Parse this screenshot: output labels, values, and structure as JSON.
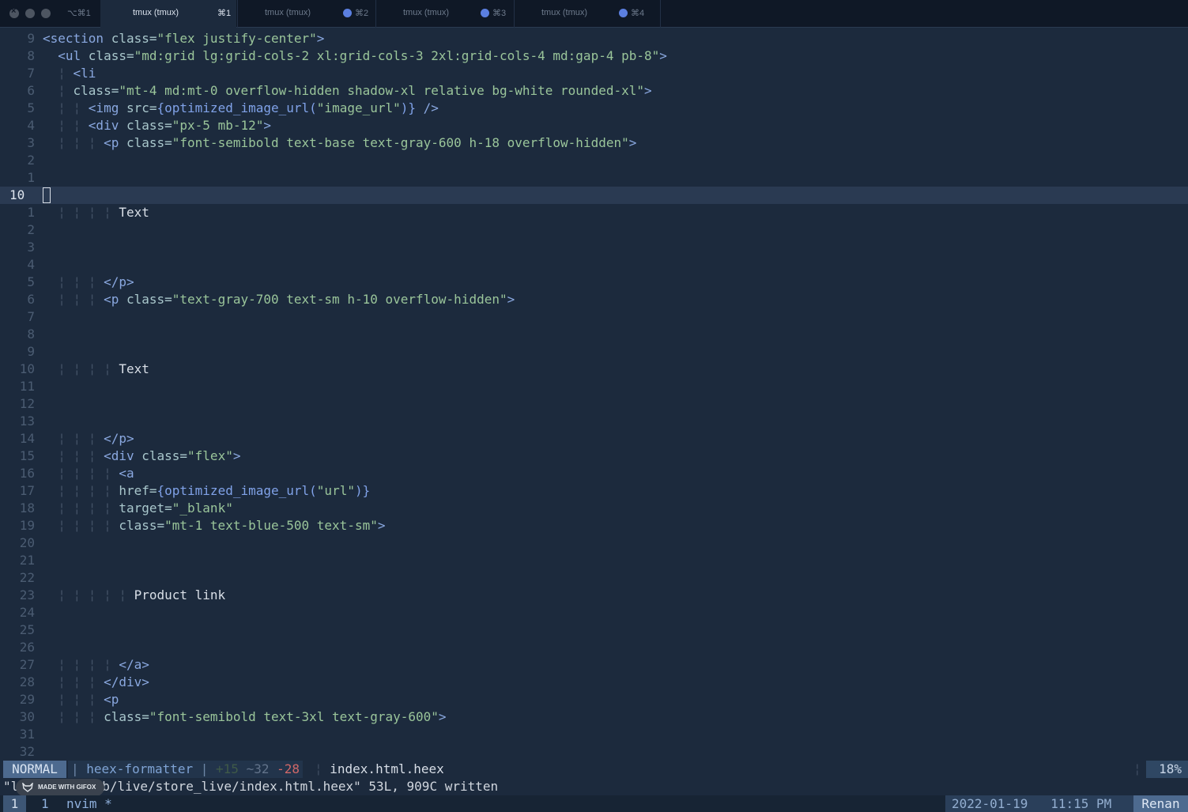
{
  "titlebar": {
    "window_shortcut": "⌥⌘1",
    "tabs": [
      {
        "title": "tmux (tmux)",
        "shortcut": "⌘1",
        "active": true
      },
      {
        "title": "tmux (tmux)",
        "shortcut": "⌘2",
        "active": false
      },
      {
        "title": "tmux (tmux)",
        "shortcut": "⌘3",
        "active": false
      },
      {
        "title": "tmux (tmux)",
        "shortcut": "⌘4",
        "active": false
      }
    ]
  },
  "editor": {
    "lines": [
      {
        "num": "9",
        "tokens": [
          {
            "c": "t",
            "v": "<section "
          },
          {
            "c": "a",
            "v": "class="
          },
          {
            "c": "s",
            "v": "\"flex justify-center\""
          },
          {
            "c": "t",
            "v": ">"
          }
        ]
      },
      {
        "num": "8",
        "tokens": [
          {
            "c": "t",
            "v": "  <ul "
          },
          {
            "c": "a",
            "v": "class="
          },
          {
            "c": "s",
            "v": "\"md:grid lg:grid-cols-2 xl:grid-cols-3 2xl:grid-cols-4 md:gap-4 pb-8\""
          },
          {
            "c": "t",
            "v": ">"
          }
        ]
      },
      {
        "num": "7",
        "tokens": [
          {
            "c": "g",
            "v": "  ¦ "
          },
          {
            "c": "t",
            "v": "<li"
          }
        ]
      },
      {
        "num": "6",
        "tokens": [
          {
            "c": "g",
            "v": "  ¦ "
          },
          {
            "c": "a",
            "v": "class="
          },
          {
            "c": "s",
            "v": "\"mt-4 md:mt-0 overflow-hidden shadow-xl relative bg-white rounded-xl\""
          },
          {
            "c": "t",
            "v": ">"
          }
        ]
      },
      {
        "num": "5",
        "tokens": [
          {
            "c": "g",
            "v": "  ¦ ¦ "
          },
          {
            "c": "t",
            "v": "<img "
          },
          {
            "c": "a",
            "v": "src="
          },
          {
            "c": "f",
            "v": "{optimized_image_url("
          },
          {
            "c": "s",
            "v": "\"image_url\""
          },
          {
            "c": "f",
            "v": ")}"
          },
          {
            "c": "t",
            "v": " />"
          }
        ]
      },
      {
        "num": "4",
        "tokens": [
          {
            "c": "g",
            "v": "  ¦ ¦ "
          },
          {
            "c": "t",
            "v": "<div "
          },
          {
            "c": "a",
            "v": "class="
          },
          {
            "c": "s",
            "v": "\"px-5 mb-12\""
          },
          {
            "c": "t",
            "v": ">"
          }
        ]
      },
      {
        "num": "3",
        "tokens": [
          {
            "c": "g",
            "v": "  ¦ ¦ ¦ "
          },
          {
            "c": "t",
            "v": "<p "
          },
          {
            "c": "a",
            "v": "class="
          },
          {
            "c": "s",
            "v": "\"font-semibold text-base text-gray-600 h-18 overflow-hidden\""
          },
          {
            "c": "t",
            "v": ">"
          }
        ]
      },
      {
        "num": "2",
        "tokens": []
      },
      {
        "num": "1",
        "tokens": []
      },
      {
        "num": "10",
        "tokens": [],
        "current": true
      },
      {
        "num": "1",
        "tokens": [
          {
            "c": "g",
            "v": "  ¦ ¦ ¦ ¦ "
          },
          {
            "c": "x",
            "v": "Text"
          }
        ]
      },
      {
        "num": "2",
        "tokens": []
      },
      {
        "num": "3",
        "tokens": []
      },
      {
        "num": "4",
        "tokens": []
      },
      {
        "num": "5",
        "tokens": [
          {
            "c": "g",
            "v": "  ¦ ¦ ¦ "
          },
          {
            "c": "t",
            "v": "</p>"
          }
        ]
      },
      {
        "num": "6",
        "tokens": [
          {
            "c": "g",
            "v": "  ¦ ¦ ¦ "
          },
          {
            "c": "t",
            "v": "<p "
          },
          {
            "c": "a",
            "v": "class="
          },
          {
            "c": "s",
            "v": "\"text-gray-700 text-sm h-10 overflow-hidden\""
          },
          {
            "c": "t",
            "v": ">"
          }
        ]
      },
      {
        "num": "7",
        "tokens": []
      },
      {
        "num": "8",
        "tokens": []
      },
      {
        "num": "9",
        "tokens": []
      },
      {
        "num": "10",
        "tokens": [
          {
            "c": "g",
            "v": "  ¦ ¦ ¦ ¦ "
          },
          {
            "c": "x",
            "v": "Text"
          }
        ]
      },
      {
        "num": "11",
        "tokens": []
      },
      {
        "num": "12",
        "tokens": []
      },
      {
        "num": "13",
        "tokens": []
      },
      {
        "num": "14",
        "tokens": [
          {
            "c": "g",
            "v": "  ¦ ¦ ¦ "
          },
          {
            "c": "t",
            "v": "</p>"
          }
        ]
      },
      {
        "num": "15",
        "tokens": [
          {
            "c": "g",
            "v": "  ¦ ¦ ¦ "
          },
          {
            "c": "t",
            "v": "<div "
          },
          {
            "c": "a",
            "v": "class="
          },
          {
            "c": "s",
            "v": "\"flex\""
          },
          {
            "c": "t",
            "v": ">"
          }
        ]
      },
      {
        "num": "16",
        "tokens": [
          {
            "c": "g",
            "v": "  ¦ ¦ ¦ ¦ "
          },
          {
            "c": "t",
            "v": "<a"
          }
        ]
      },
      {
        "num": "17",
        "tokens": [
          {
            "c": "g",
            "v": "  ¦ ¦ ¦ ¦ "
          },
          {
            "c": "a",
            "v": "href="
          },
          {
            "c": "f",
            "v": "{optimized_image_url("
          },
          {
            "c": "s",
            "v": "\"url\""
          },
          {
            "c": "f",
            "v": ")}"
          }
        ]
      },
      {
        "num": "18",
        "tokens": [
          {
            "c": "g",
            "v": "  ¦ ¦ ¦ ¦ "
          },
          {
            "c": "a",
            "v": "target="
          },
          {
            "c": "s",
            "v": "\"_blank\""
          }
        ]
      },
      {
        "num": "19",
        "tokens": [
          {
            "c": "g",
            "v": "  ¦ ¦ ¦ ¦ "
          },
          {
            "c": "a",
            "v": "class="
          },
          {
            "c": "s",
            "v": "\"mt-1 text-blue-500 text-sm\""
          },
          {
            "c": "t",
            "v": ">"
          }
        ]
      },
      {
        "num": "20",
        "tokens": []
      },
      {
        "num": "21",
        "tokens": []
      },
      {
        "num": "22",
        "tokens": []
      },
      {
        "num": "23",
        "tokens": [
          {
            "c": "g",
            "v": "  ¦ ¦ ¦ ¦ ¦ "
          },
          {
            "c": "x",
            "v": "Product link"
          }
        ]
      },
      {
        "num": "24",
        "tokens": []
      },
      {
        "num": "25",
        "tokens": []
      },
      {
        "num": "26",
        "tokens": []
      },
      {
        "num": "27",
        "tokens": [
          {
            "c": "g",
            "v": "  ¦ ¦ ¦ ¦ "
          },
          {
            "c": "t",
            "v": "</a>"
          }
        ]
      },
      {
        "num": "28",
        "tokens": [
          {
            "c": "g",
            "v": "  ¦ ¦ ¦ "
          },
          {
            "c": "t",
            "v": "</div>"
          }
        ]
      },
      {
        "num": "29",
        "tokens": [
          {
            "c": "g",
            "v": "  ¦ ¦ ¦ "
          },
          {
            "c": "t",
            "v": "<p"
          }
        ]
      },
      {
        "num": "30",
        "tokens": [
          {
            "c": "g",
            "v": "  ¦ ¦ ¦ "
          },
          {
            "c": "a",
            "v": "class="
          },
          {
            "c": "s",
            "v": "\"font-semibold text-3xl text-gray-600\""
          },
          {
            "c": "t",
            "v": ">"
          }
        ]
      },
      {
        "num": "31",
        "tokens": []
      },
      {
        "num": "32",
        "tokens": []
      }
    ]
  },
  "statusline": {
    "mode": "NORMAL",
    "formatter": "heex-formatter",
    "git_added": "+15",
    "git_modified": "~32",
    "git_removed": "-28",
    "filename": "index.html.heex",
    "percent": "18%"
  },
  "message": {
    "text": "\"lib/store_web/live/store_live/index.html.heex\" 53L, 909C written",
    "overlay_badge": "MADE WITH GIFOX"
  },
  "tmux": {
    "session": "1",
    "window_number": "1",
    "window_name": "nvim *",
    "date": "2022-01-19",
    "time": "11:15 PM",
    "user": "Renan"
  }
}
